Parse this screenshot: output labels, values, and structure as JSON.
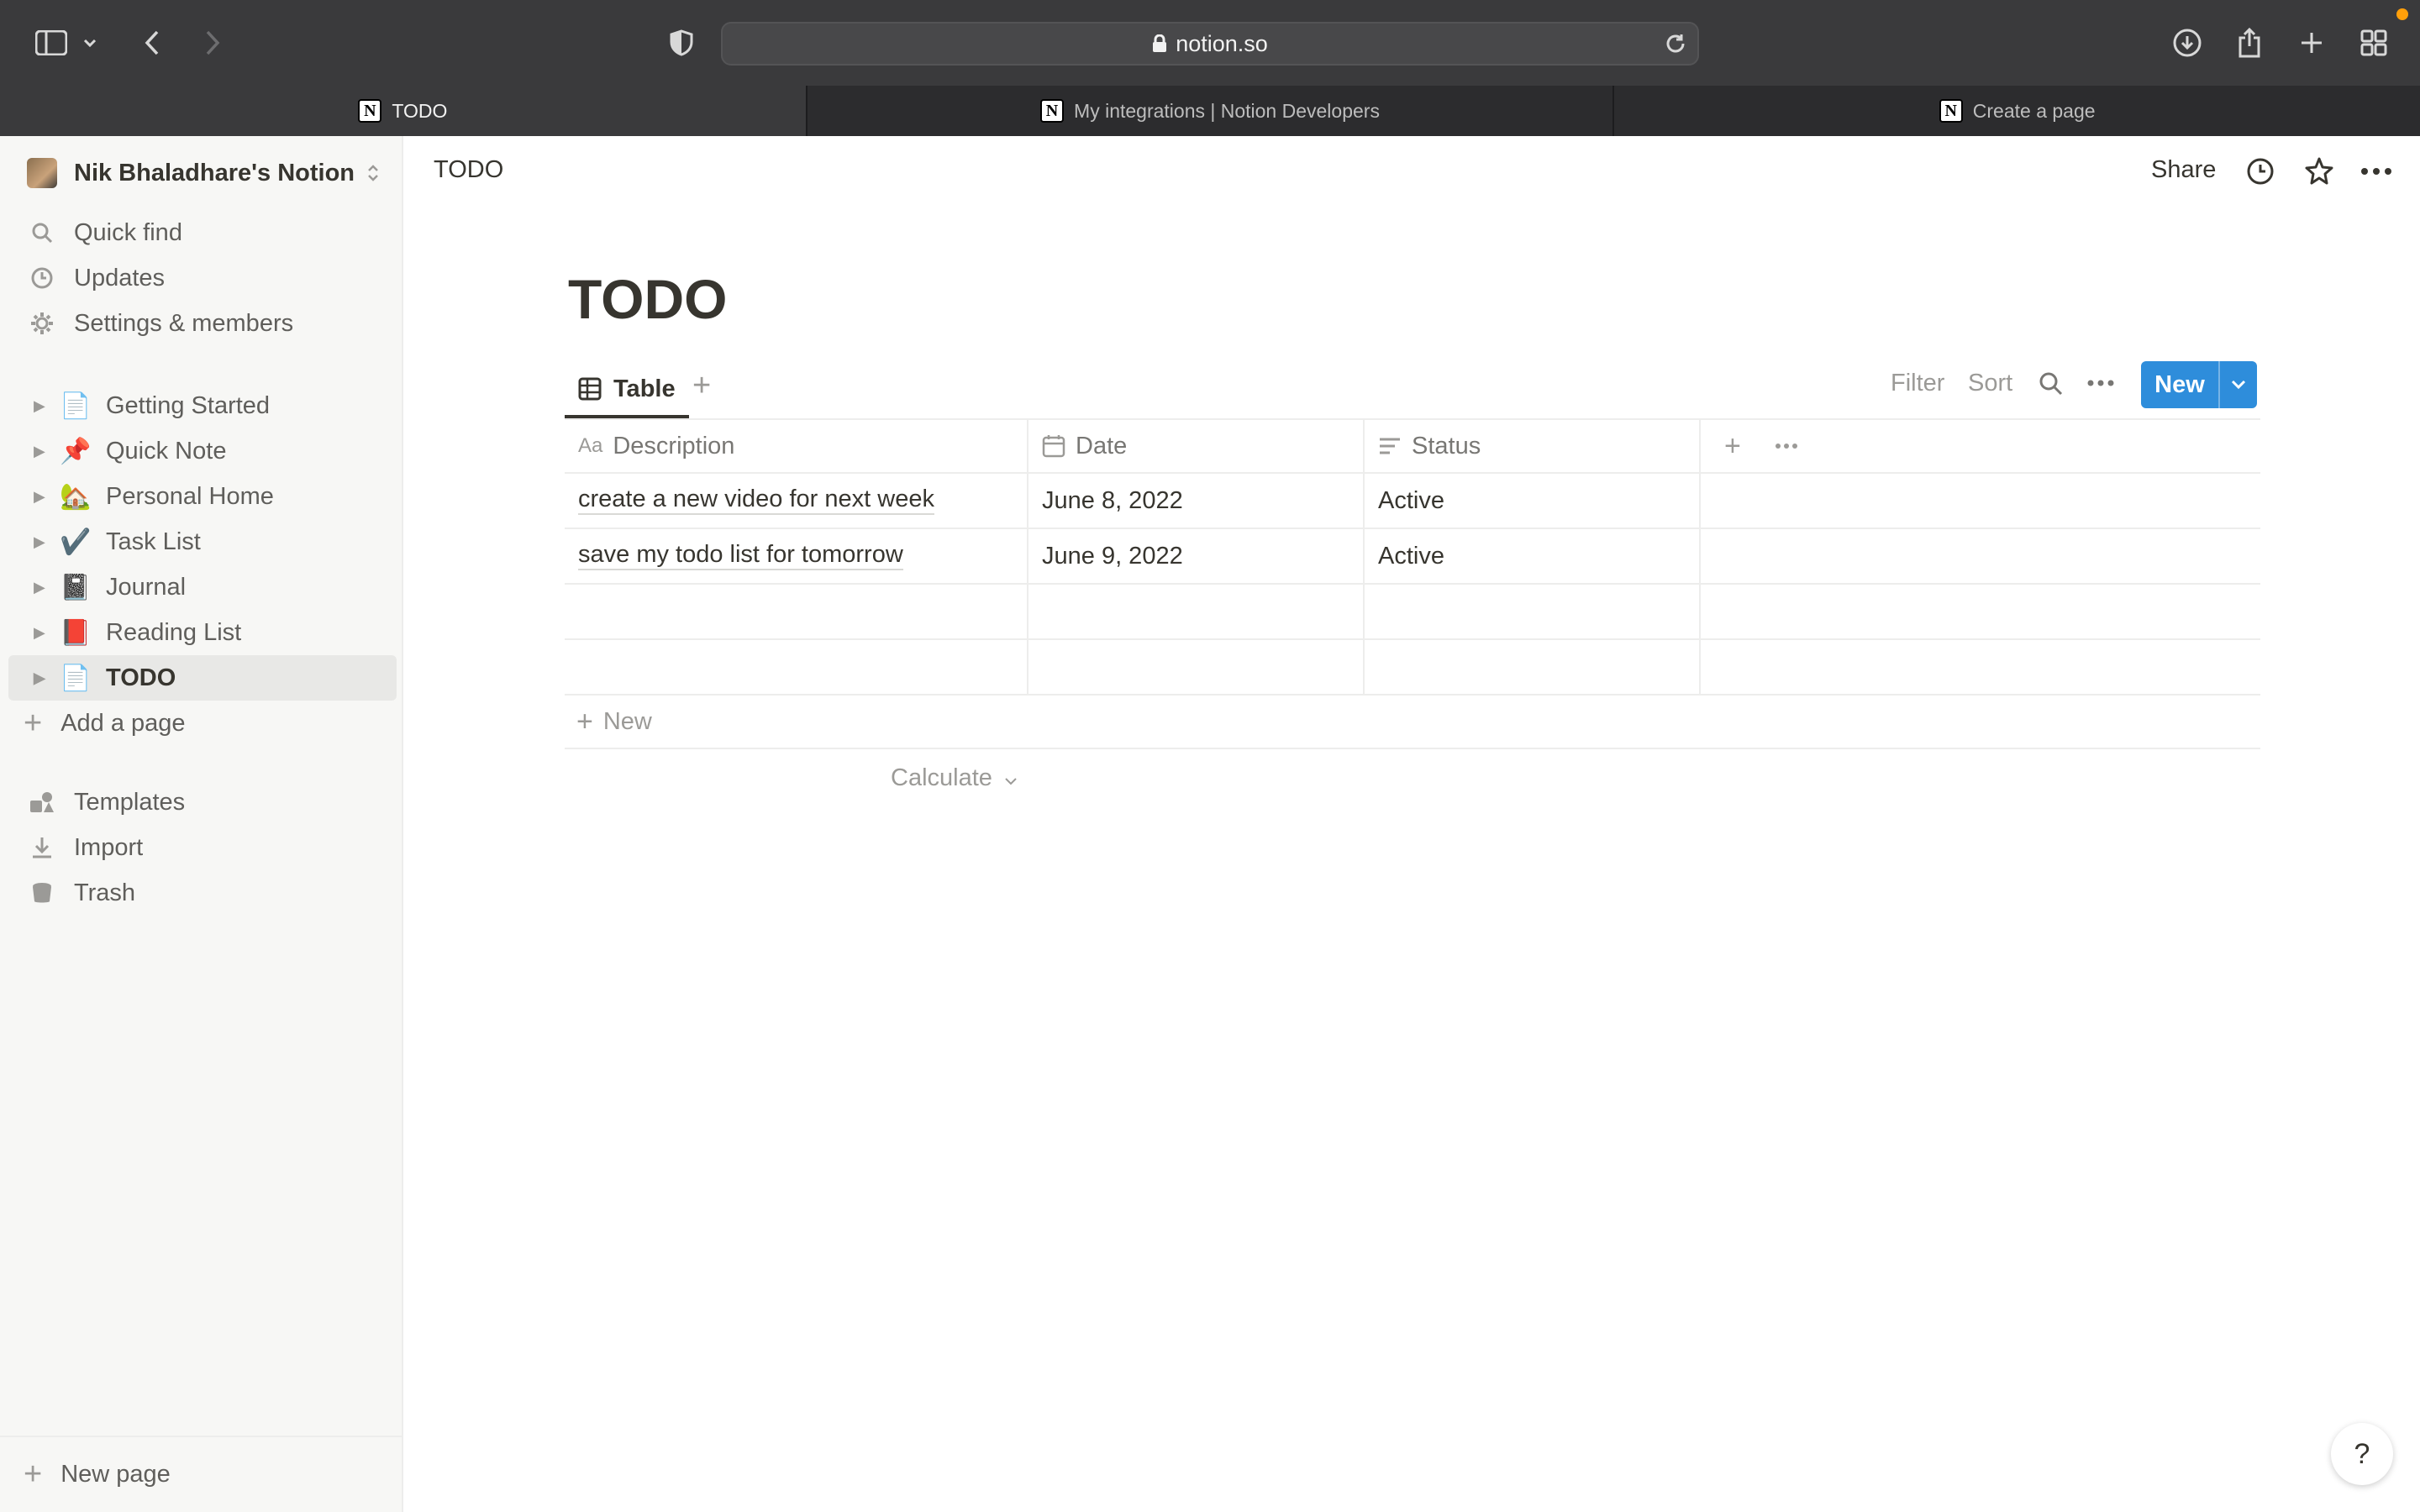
{
  "browser": {
    "url": "notion.so",
    "tabs": [
      {
        "title": "TODO"
      },
      {
        "title": "My integrations | Notion Developers"
      },
      {
        "title": "Create a page"
      }
    ]
  },
  "sidebar": {
    "workspace": "Nik Bhaladhare's Notion",
    "nav": [
      {
        "label": "Quick find",
        "icon": "search-icon"
      },
      {
        "label": "Updates",
        "icon": "clock-icon"
      },
      {
        "label": "Settings & members",
        "icon": "gear-icon"
      }
    ],
    "pages": [
      {
        "label": "Getting Started",
        "emoji": "📄"
      },
      {
        "label": "Quick Note",
        "emoji": "📌"
      },
      {
        "label": "Personal Home",
        "emoji": "🏡"
      },
      {
        "label": "Task List",
        "emoji": "✔️"
      },
      {
        "label": "Journal",
        "emoji": "📓"
      },
      {
        "label": "Reading List",
        "emoji": "📕"
      },
      {
        "label": "TODO",
        "emoji": "📄"
      }
    ],
    "add_page": "Add a page",
    "tools": [
      {
        "label": "Templates",
        "icon": "templates-icon"
      },
      {
        "label": "Import",
        "icon": "import-icon"
      },
      {
        "label": "Trash",
        "icon": "trash-icon"
      }
    ],
    "new_page": "New page"
  },
  "topbar": {
    "breadcrumb": "TODO",
    "share": "Share"
  },
  "page": {
    "title": "TODO",
    "view_tab": "Table",
    "controls": {
      "filter": "Filter",
      "sort": "Sort",
      "new": "New"
    },
    "columns": [
      "Description",
      "Date",
      "Status"
    ],
    "rows": [
      {
        "description": "create a new video for next week",
        "date": "June 8, 2022",
        "status": "Active"
      },
      {
        "description": "save my todo list for tomorrow",
        "date": "June 9, 2022",
        "status": "Active"
      }
    ],
    "new_row": "New",
    "calculate": "Calculate"
  },
  "help": "?",
  "colors": {
    "accent": "#2e8ddb",
    "sidebar_bg": "#f7f7f5",
    "text": "#37352f",
    "chrome": "#3a3a3c"
  }
}
